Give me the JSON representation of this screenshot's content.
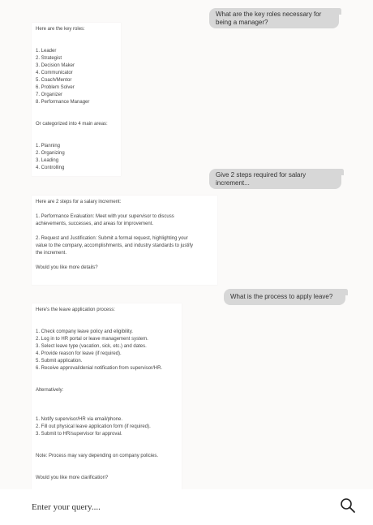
{
  "conversation": [
    {
      "role": "user",
      "text": "What are the key roles necessary for being a manager?"
    },
    {
      "role": "assistant",
      "lines": [
        "Here are the key roles:",
        "",
        "",
        "1. Leader",
        "2. Strategist",
        "3. Decision Maker",
        "4. Communicator",
        "5. Coach/Mentor",
        "6. Problem Solver",
        "7. Organizer",
        "8. Performance Manager",
        "",
        "",
        "Or categorized into 4 main areas:",
        "",
        "",
        "1. Planning",
        "2. Organizing",
        "3. Leading",
        "4. Controlling"
      ]
    },
    {
      "role": "user",
      "text": "Give 2 steps required for salary increment..."
    },
    {
      "role": "assistant",
      "lines": [
        "Here are 2 steps for a salary increment:",
        "",
        "1. Performance Evaluation: Meet with your supervisor to discuss",
        "achievements, successes, and areas for improvement.",
        "",
        "2. Request and Justification: Submit a formal request, highlighting your",
        "value to the company, accomplishments, and industry standards to justify",
        "the increment.",
        "",
        "Would you like more details?"
      ]
    },
    {
      "role": "user",
      "text": "What is the process to apply leave?"
    },
    {
      "role": "assistant",
      "lines": [
        "Here's the leave application process:",
        "",
        "",
        "1. Check company leave policy and eligibility.",
        "2. Log in to HR portal or leave management system.",
        "3. Select leave type (vacation, sick, etc.) and dates.",
        "4. Provide reason for leave (if required).",
        "5. Submit application.",
        "6. Receive approval/denial notification from supervisor/HR.",
        "",
        "",
        "Alternatively:",
        "",
        "",
        "",
        "1. Notify supervisor/HR via email/phone.",
        "2. Fill out physical leave application form (if required).",
        "3. Submit to HR/supervisor for approval.",
        "",
        "",
        "Note: Process may vary depending on company policies.",
        "",
        "",
        "Would you like more clarification?"
      ]
    }
  ],
  "input": {
    "placeholder": "Enter your query...."
  },
  "icons": {
    "search": "search-icon"
  }
}
